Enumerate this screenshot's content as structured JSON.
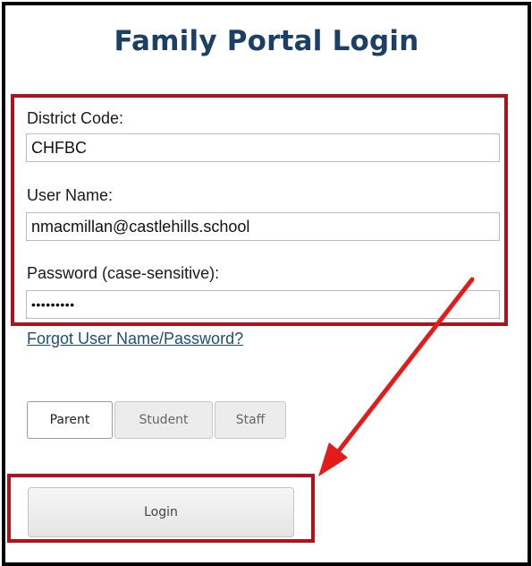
{
  "page": {
    "title": "Family Portal Login"
  },
  "form": {
    "district_code": {
      "label": "District Code:",
      "value": "CHFBC"
    },
    "user_name": {
      "label": "User Name:",
      "value": "nmacmillan@castlehills.school"
    },
    "password": {
      "label": "Password (case-sensitive):",
      "value": "•••••••••"
    },
    "forgot_link": "Forgot User Name/Password?",
    "roles": [
      {
        "label": "Parent",
        "selected": true
      },
      {
        "label": "Student",
        "selected": false
      },
      {
        "label": "Staff",
        "selected": false
      }
    ],
    "login_label": "Login"
  },
  "annotations": {
    "highlight_color": "#b0121b",
    "arrow_color": "#e31b1b"
  }
}
